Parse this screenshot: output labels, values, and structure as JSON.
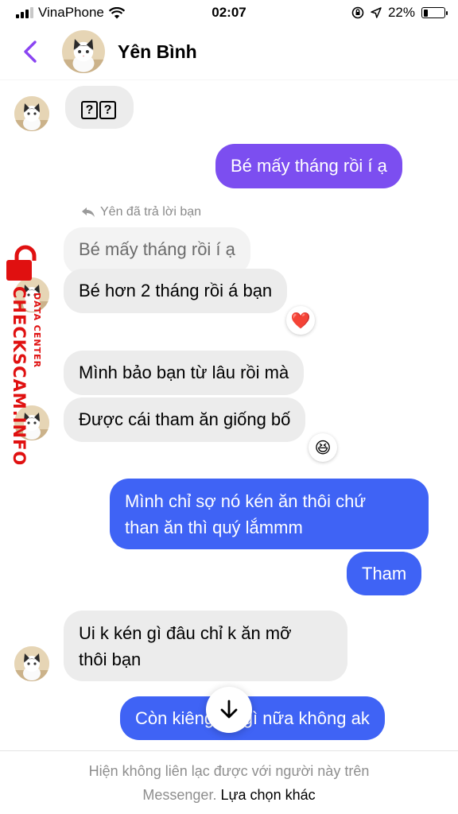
{
  "status_bar": {
    "carrier": "VinaPhone",
    "time": "02:07",
    "battery_text": "22%",
    "battery_level": 0.22
  },
  "header": {
    "contact_name": "Yên Bình",
    "back_icon": "chevron-left-icon",
    "accent_color": "#8a44f2"
  },
  "messages": {
    "m1_placeholder_boxes": [
      "?",
      "?"
    ],
    "m2": "Bé mấy tháng rồi í ạ",
    "reply_note": "Yên đã trả lời bạn",
    "m3_quoted": "Bé mấy tháng rồi í ạ",
    "m3_reply": "Bé hơn 2 tháng rồi á bạn",
    "m3_reaction": "❤️",
    "m4": "Mình bảo bạn từ lâu rồi mà",
    "m5": "Được cái tham ăn giống bố",
    "m5_reaction": "😆",
    "m6_line1": "Mình chỉ sợ nó kén ăn thôi chứ",
    "m6_line2": "than ăn thì quý lắmmm",
    "m7": "Tham",
    "m8_line1": "Ui k kén gì đâu chỉ k ăn mỡ",
    "m8_line2": "thôi bạn",
    "m9": "Còn kiêng ăn gì nữa không ak"
  },
  "colors": {
    "outgoing_purple": "#7c4ef0",
    "outgoing_blue": "#3f63f5",
    "incoming_gray": "#ececec"
  },
  "scroll_button_icon": "arrow-down-icon",
  "footer": {
    "notice_line1": "Hiện không liên lạc được với người này trên",
    "notice_line2": "Messenger.",
    "choose_other": "Lựa chọn khác"
  },
  "watermark": {
    "main": "CHECKSCAM.INFO",
    "sub": "DATA CENTER"
  }
}
